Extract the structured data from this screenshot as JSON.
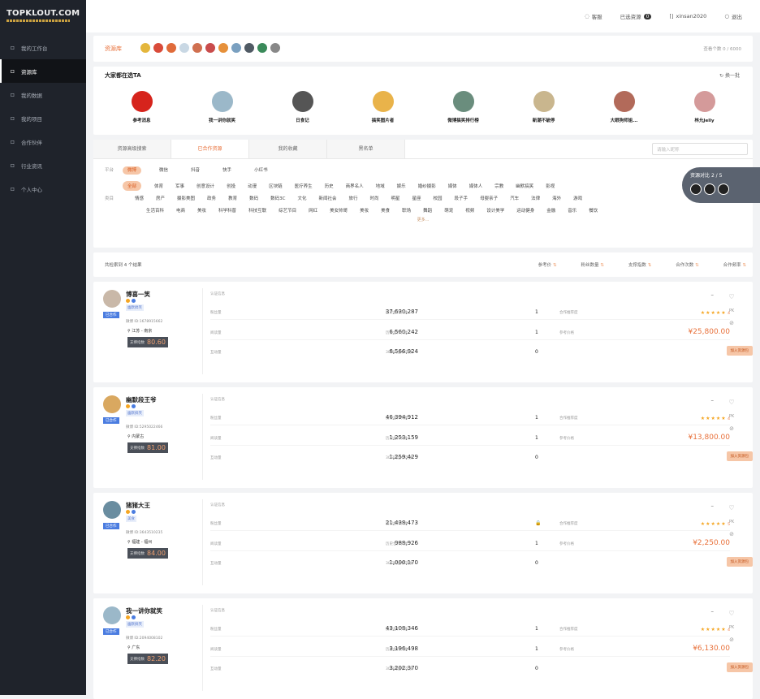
{
  "app": {
    "logo_text": "TOPKLOUT.COM"
  },
  "sidebar": {
    "items": [
      {
        "label": "我的工作台",
        "icon": "dashboard-icon",
        "active": false
      },
      {
        "label": "资源库",
        "icon": "library-icon",
        "active": true
      },
      {
        "label": "我的数据",
        "icon": "chart-icon",
        "active": false
      },
      {
        "label": "我的项目",
        "icon": "folder-icon",
        "active": false
      },
      {
        "label": "合作伙伴",
        "icon": "partner-icon",
        "active": false
      },
      {
        "label": "行业资讯",
        "icon": "news-icon",
        "active": false
      },
      {
        "label": "个人中心",
        "icon": "user-icon",
        "active": false
      }
    ]
  },
  "topbar": {
    "service": "客服",
    "selected_label": "已选资源",
    "selected_count": "0",
    "user": "xinsan2020",
    "logout": "退出"
  },
  "resource_bar": {
    "label": "资源库",
    "right_text": "查看个数 0 / 6000"
  },
  "recommend": {
    "title": "大家都在选TA",
    "swap": "换一批",
    "items": [
      {
        "name": "参考消息",
        "color": "#d6241c"
      },
      {
        "name": "我一讲你就笑",
        "color": "#9bb8c9"
      },
      {
        "name": "日食记",
        "color": "#555555"
      },
      {
        "name": "搞笑图片者",
        "color": "#e9b34a"
      },
      {
        "name": "微博搞笑排行榜",
        "color": "#6a8d7d"
      },
      {
        "name": "新潮不破停",
        "color": "#c9b68e"
      },
      {
        "name": "大眼狗师姐...",
        "color": "#b26a5a"
      },
      {
        "name": "林允Jelly",
        "color": "#d49a9a"
      }
    ]
  },
  "filter": {
    "tabs": [
      "资源高级搜索",
      "已合作资源",
      "我的收藏",
      "黑名单"
    ],
    "active_tab": 1,
    "search_placeholder": "请输入昵称",
    "platform_label": "平台",
    "platforms": [
      "微博",
      "微信",
      "抖音",
      "快手",
      "小红书"
    ],
    "category_label": "类目",
    "row1": [
      "全部",
      "体育",
      "军事",
      "创意设计",
      "创投",
      "动漫",
      "区块链",
      "医疗养生",
      "历史",
      "商界名人",
      "地域",
      "娱乐",
      "婚纱摄影",
      "媒体",
      "媒体人",
      "宗教",
      "幽默搞笑",
      "影视"
    ],
    "row2": [
      "情感",
      "房产",
      "摄影美图",
      "政务",
      "教育",
      "数码",
      "数码3C",
      "文化",
      "新闻社会",
      "旅行",
      "时尚",
      "明星",
      "星座",
      "校园",
      "段子手",
      "母婴亲子",
      "汽车",
      "法律",
      "海外",
      "游戏"
    ],
    "row3": [
      "生活百科",
      "电商",
      "美妆",
      "科学科普",
      "科技互联",
      "综艺节目",
      "网红",
      "美女帅哥",
      "美妆",
      "美食",
      "职场",
      "舞蹈",
      "萌宠",
      "视频",
      "设计美学",
      "运动健身",
      "金融",
      "音乐",
      "餐饮"
    ],
    "more": "更多..."
  },
  "compare": {
    "label": "资源对比",
    "count": "2 / 5"
  },
  "sortbar": {
    "result": "共检索到 4 个结果",
    "sorts": [
      "参考价",
      "粉丝数量",
      "支撑指数",
      "合作次数",
      "合作频率"
    ]
  },
  "influencers": [
    {
      "name": "博喜一笑",
      "coop_badge": "已合作",
      "tag": "幽默搞笑",
      "weibo_id": "微博 ID:1678915662",
      "location": "江苏 - 南京",
      "index_label": "支撑指数",
      "index_value": "80.60",
      "avatar_color": "#c9b8a8",
      "section": "认证信息",
      "l1": "粉丝量",
      "fans": "37,630,287",
      "l2": "历史合作次数",
      "hist": "1",
      "l3": "合作推荐度",
      "stars": "★★★★★",
      "rating": "4",
      "l4": "阅读量",
      "reads": "6,560,242",
      "l5": "历史合作次数",
      "hist2": "1",
      "l6": "参考价格",
      "price": "¥25,800.00",
      "l7": "互动量",
      "inter": "6,566,924",
      "l8": "30日内合作次数",
      "recent": "0"
    },
    {
      "name": "幽默段王爷",
      "coop_badge": "已合作",
      "tag": "幽默搞笑",
      "weibo_id": "微博 ID:5295022466",
      "location": "内蒙古",
      "index_label": "支撑指数",
      "index_value": "81.00",
      "avatar_color": "#d9a860",
      "section": "认证信息",
      "l1": "粉丝量",
      "fans": "46,394,912",
      "l2": "历史合作次数",
      "hist": "1",
      "l3": "合作推荐度",
      "stars": "★★★★★",
      "rating": "4",
      "l4": "阅读量",
      "reads": "1,253,159",
      "l5": "历史合作次数",
      "hist2": "1",
      "l6": "参考价格",
      "price": "¥13,800.00",
      "l7": "互动量",
      "inter": "1,259,429",
      "l8": "30日内合作次数",
      "recent": "0"
    },
    {
      "name": "猪猪大王",
      "coop_badge": "已合作",
      "tag": "美食",
      "weibo_id": "微博 ID:3643510235",
      "location": "福建 - 福州",
      "index_label": "支撑指数",
      "index_value": "84.00",
      "avatar_color": "#6a8da0",
      "section": "认证信息",
      "l1": "粉丝量",
      "fans": "21,438,473",
      "l2": "历史合作次数",
      "hist": "🔒",
      "l3": "合作推荐度",
      "stars": "★★★★★",
      "rating": "5",
      "l4": "阅读量",
      "reads": "988,926",
      "l5": "历史合作次数",
      "hist2": "1",
      "l6": "参考价格",
      "price": "¥2,250.00",
      "l7": "互动量",
      "inter": "1,000,170",
      "l8": "30日内合作次数",
      "recent": "0"
    },
    {
      "name": "我一讲你就笑",
      "coop_badge": "已合作",
      "tag": "幽默搞笑",
      "weibo_id": "微博 ID:2094008102",
      "location": "广东",
      "index_label": "支撑指数",
      "index_value": "82.20",
      "avatar_color": "#9bb8c9",
      "section": "认证信息",
      "l1": "粉丝量",
      "fans": "43,108,346",
      "l2": "历史合作次数",
      "hist": "1",
      "l3": "合作推荐度",
      "stars": "★★★★★",
      "rating": "4",
      "l4": "阅读量",
      "reads": "3,196,498",
      "l5": "历史合作次数",
      "hist2": "1",
      "l6": "参考价格",
      "price": "¥6,130.00",
      "l7": "互动量",
      "inter": "3,202,370",
      "l8": "30日内合作次数",
      "recent": "0"
    }
  ],
  "card_actions": {
    "favorite": "♡",
    "pk": "PK",
    "block": "⊘",
    "add": "加入资源包",
    "dash": "–"
  },
  "mini_avatar_colors": [
    "#e4b63c",
    "#d94b3a",
    "#e06b3a",
    "#c9d8e4",
    "#d07050",
    "#c94c4c",
    "#e6903a",
    "#7aa0c0",
    "#505a64",
    "#3a8a5a",
    "#888888"
  ]
}
